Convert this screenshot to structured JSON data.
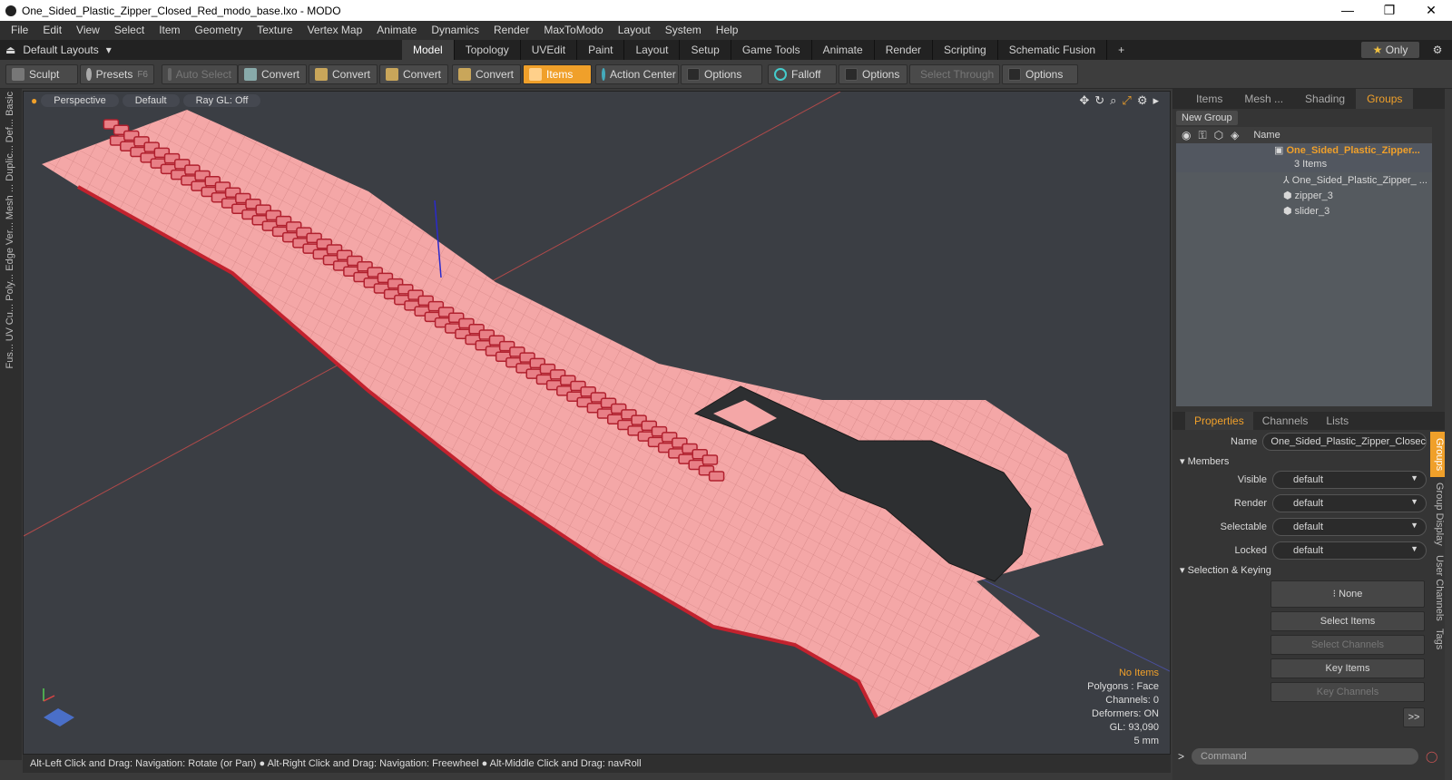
{
  "window": {
    "title": "One_Sided_Plastic_Zipper_Closed_Red_modo_base.lxo - MODO",
    "controls": [
      "—",
      "❐",
      "✕"
    ]
  },
  "menu": [
    "File",
    "Edit",
    "View",
    "Select",
    "Item",
    "Geometry",
    "Texture",
    "Vertex Map",
    "Animate",
    "Dynamics",
    "Render",
    "MaxToModo",
    "Layout",
    "System",
    "Help"
  ],
  "layout": {
    "label": "Default Layouts",
    "tabs": [
      "Model",
      "Topology",
      "UVEdit",
      "Paint",
      "Layout",
      "Setup",
      "Game Tools",
      "Animate",
      "Render",
      "Scripting",
      "Schematic Fusion"
    ],
    "active_tab": "Model",
    "add": "+",
    "only": "Only"
  },
  "toolbar": {
    "sculpt": "Sculpt",
    "presets": "Presets",
    "presets_key": "F6",
    "auto_select": "Auto Select",
    "convert1": "Convert",
    "convert2": "Convert",
    "convert3": "Convert",
    "convert4": "Convert",
    "items": "Items",
    "action_center": "Action Center",
    "options1": "Options",
    "falloff": "Falloff",
    "options2": "Options",
    "select_through": "Select Through",
    "options3": "Options"
  },
  "left_strip": [
    "Basic",
    "Def...",
    "Duplic...",
    "Mesh ...",
    "Ver...",
    "Edge",
    "Poly...",
    "Cu...",
    "UV",
    "Fus..."
  ],
  "viewport": {
    "projection": "Perspective",
    "shading": "Default",
    "raygl": "Ray GL: Off",
    "info": {
      "no_items": "No Items",
      "polygons": "Polygons : Face",
      "channels": "Channels: 0",
      "deformers": "Deformers: ON",
      "gl": "GL: 93,090",
      "scale": "5 mm"
    },
    "colors": {
      "fabric": "#f4a7a7",
      "teeth": "#e87f86",
      "slider": "#2d2f31",
      "bg": "#3b3e44"
    }
  },
  "statusbar": "Alt-Left Click and Drag: Navigation: Rotate (or Pan) ● Alt-Right Click and Drag: Navigation: Freewheel ● Alt-Middle Click and Drag: navRoll",
  "right": {
    "tabs": [
      "Items",
      "Mesh ...",
      "Shading",
      "Groups"
    ],
    "active_tab": "Groups",
    "new_group": "New Group",
    "name_col": "Name",
    "group_name": "One_Sided_Plastic_Zipper...",
    "group_count": "3 Items",
    "children": [
      "One_Sided_Plastic_Zipper_ ...",
      "zipper_3",
      "slider_3"
    ],
    "prop_tabs": [
      "Properties",
      "Channels",
      "Lists"
    ],
    "prop_active": "Properties",
    "name_label": "Name",
    "name_value": "One_Sided_Plastic_Zipper_Closec",
    "members": "Members",
    "visible_label": "Visible",
    "render_label": "Render",
    "selectable_label": "Selectable",
    "locked_label": "Locked",
    "default_value": "default",
    "selection_keying": "Selection & Keying",
    "none": "None",
    "select_items": "Select Items",
    "select_channels": "Select Channels",
    "key_items": "Key Items",
    "key_channels": "Key Channels",
    "more": ">>",
    "side_tabs": [
      "Groups",
      "Group Display",
      "User Channels",
      "Tags"
    ],
    "command": "Command"
  }
}
